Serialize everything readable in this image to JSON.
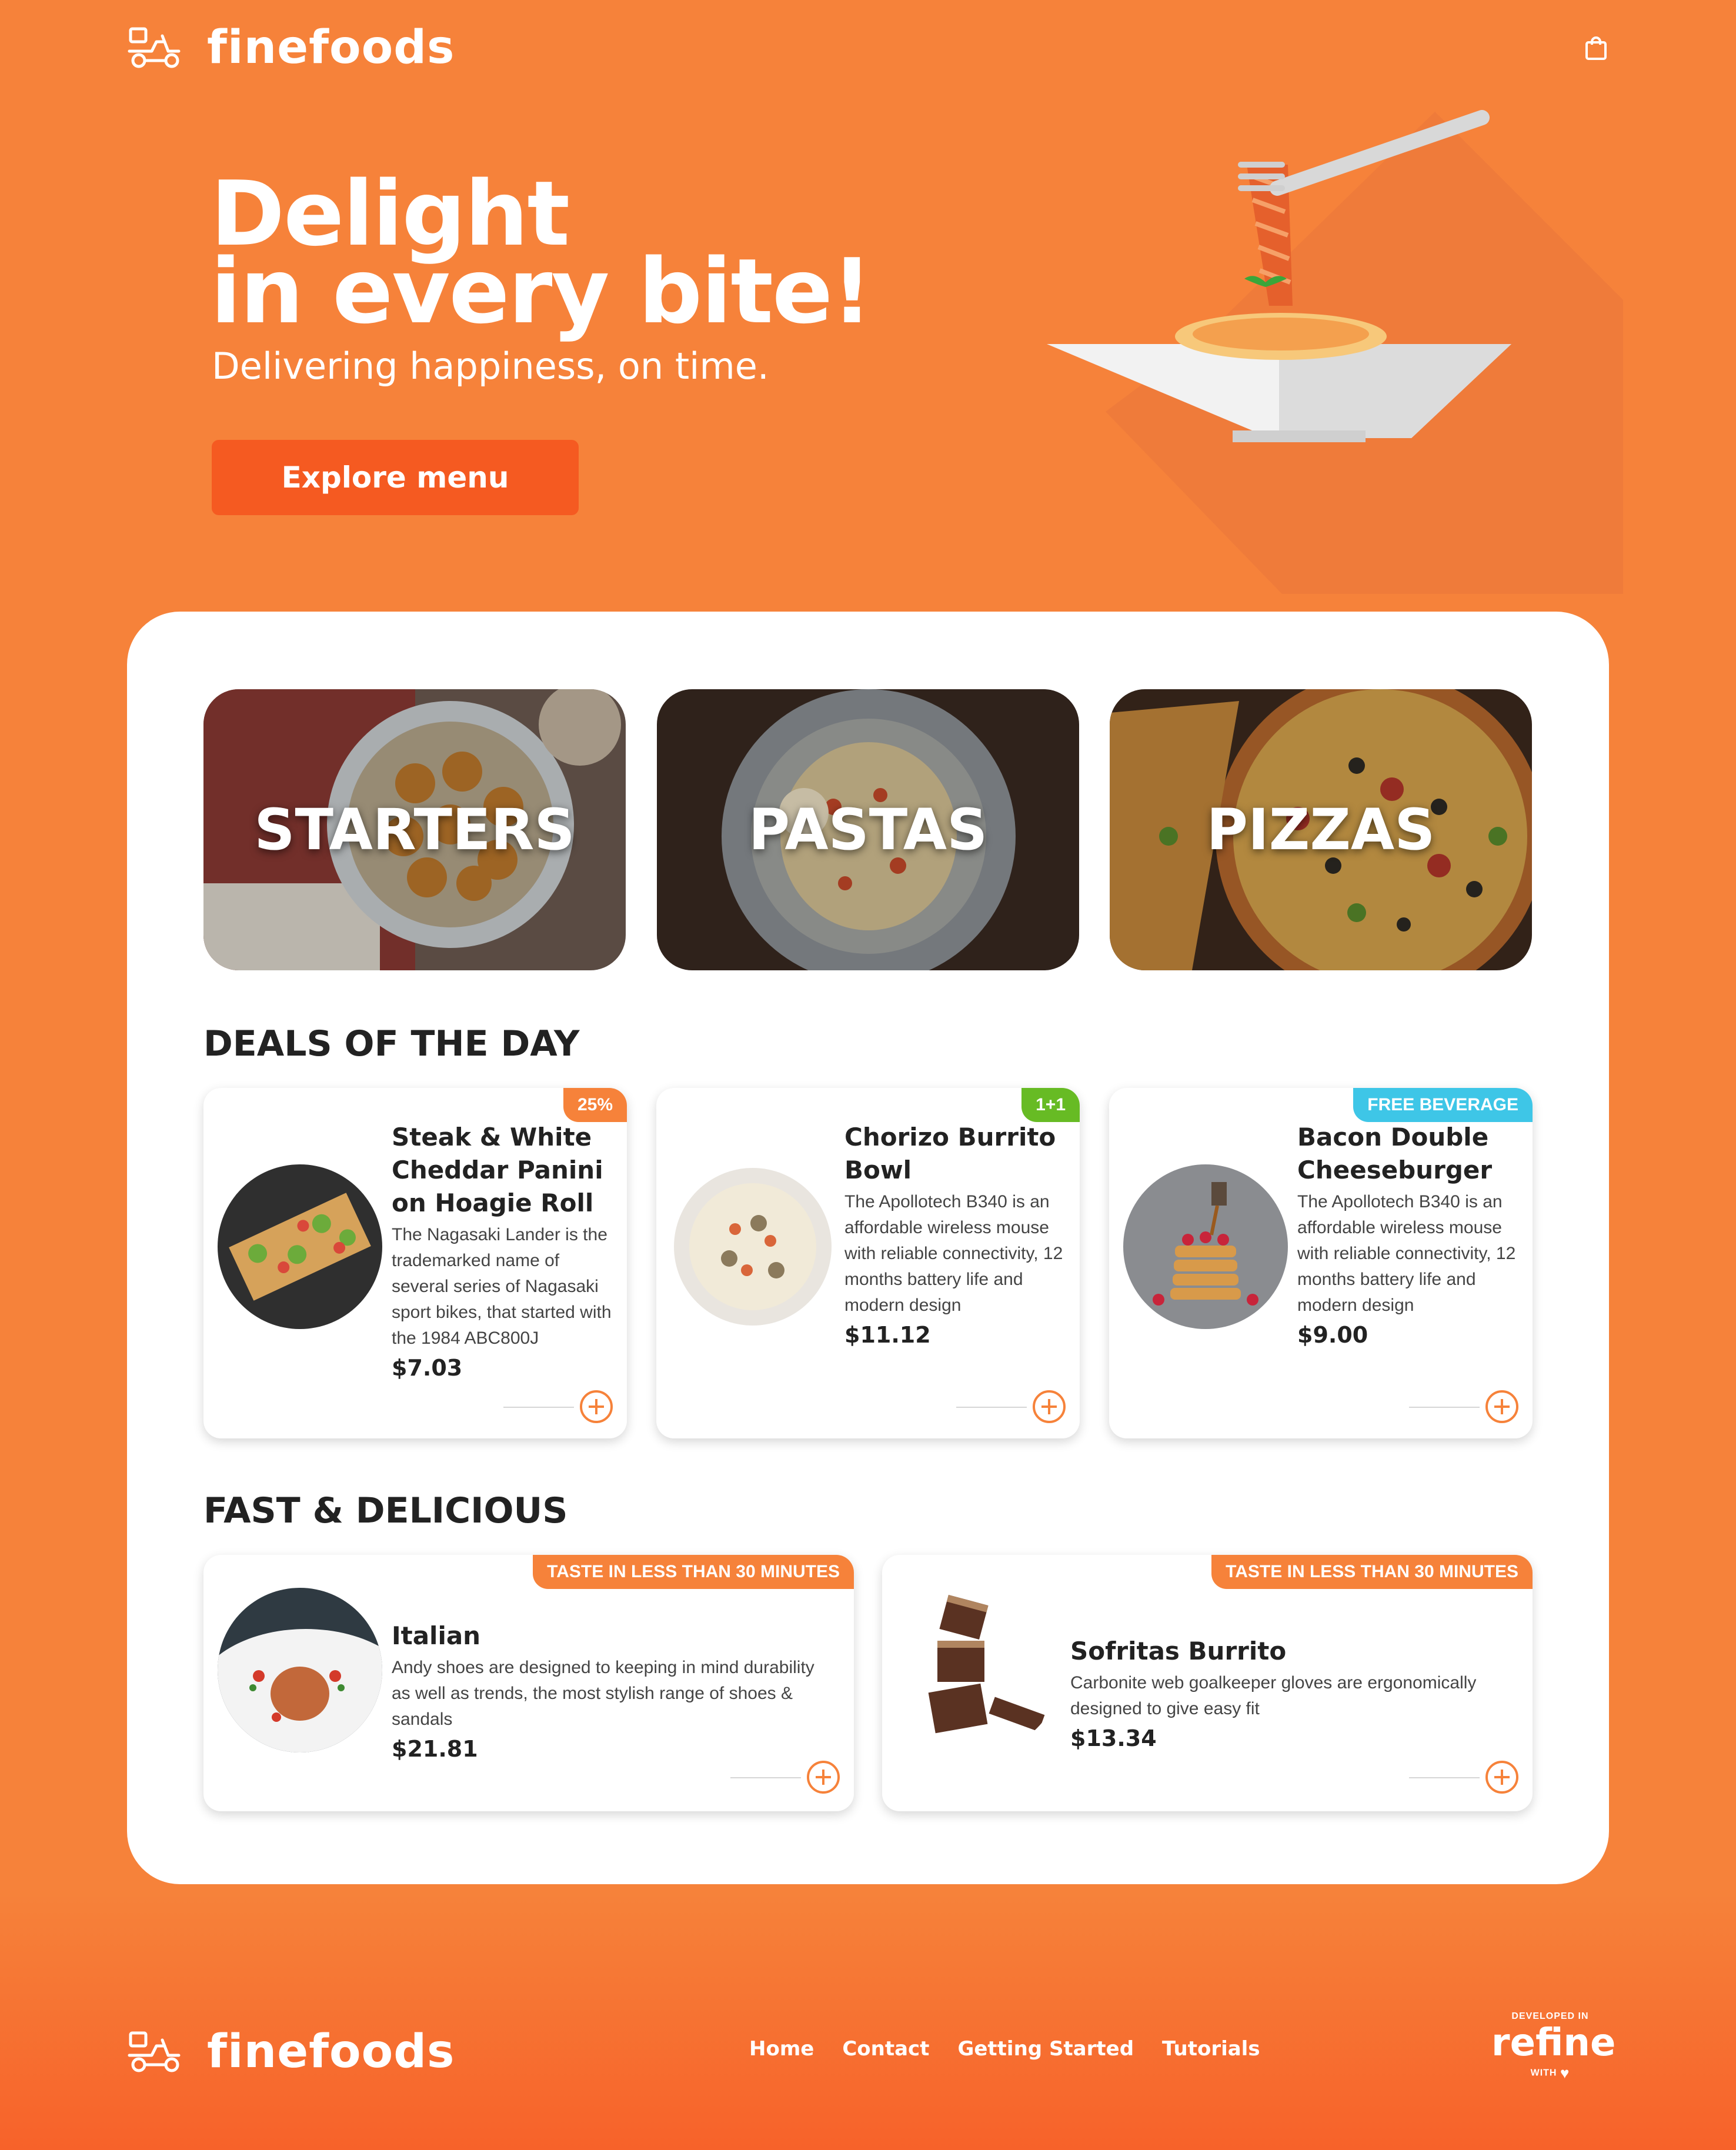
{
  "brand": {
    "name": "finefoods"
  },
  "header": {
    "cart_icon": "shopping-bag-icon"
  },
  "hero": {
    "title_line1": "Delight",
    "title_line2": "in every bite!",
    "subtitle": "Delivering happiness, on time.",
    "cta_label": "Explore menu"
  },
  "categories": [
    {
      "label": "STARTERS"
    },
    {
      "label": "PASTAS"
    },
    {
      "label": "PIZZAS"
    }
  ],
  "deals": {
    "title": "DEALS OF THE DAY",
    "items": [
      {
        "badge": "25%",
        "name": "Steak & White Cheddar Panini on Hoagie Roll",
        "description": "The Nagasaki Lander is the trademarked name of several series of Nagasaki sport bikes, that started with the 1984 ABC800J",
        "price": "$7.03"
      },
      {
        "badge": "1+1",
        "name": "Chorizo Burrito Bowl",
        "description": "The Apollotech B340 is an affordable wireless mouse with reliable connectivity, 12 months battery life and modern design",
        "price": "$11.12"
      },
      {
        "badge": "FREE BEVERAGE",
        "name": "Bacon Double Cheeseburger",
        "description": "The Apollotech B340 is an affordable wireless mouse with reliable connectivity, 12 months battery life and modern design",
        "price": "$9.00"
      }
    ]
  },
  "fast": {
    "title": "FAST & DELICIOUS",
    "items": [
      {
        "badge": "TASTE IN LESS THAN 30 MINUTES",
        "name": "Italian",
        "description": "Andy shoes are designed to keeping in mind durability as well as trends, the most stylish range of shoes & sandals",
        "price": "$21.81"
      },
      {
        "badge": "TASTE IN LESS THAN 30 MINUTES",
        "name": "Sofritas Burrito",
        "description": "Carbonite web goalkeeper gloves are ergonomically designed to give easy fit",
        "price": "$13.34"
      }
    ]
  },
  "footer": {
    "nav": [
      "Home",
      "Contact",
      "Getting Started",
      "Tutorials"
    ],
    "badge_top": "DEVELOPED IN",
    "badge_name": "refine",
    "badge_bottom": "WITH"
  },
  "colors": {
    "primary": "#f6823a",
    "cta": "#f55a21",
    "badge_green": "#67bb24",
    "badge_blue": "#3ec6e7"
  }
}
